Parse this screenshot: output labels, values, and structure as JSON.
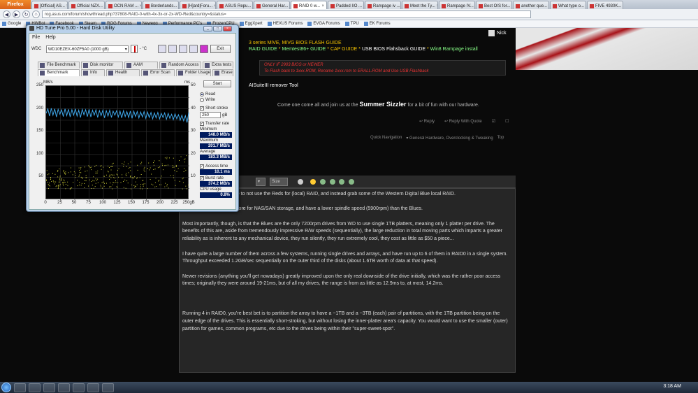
{
  "browser": {
    "app_button": "Firefox",
    "tabs": [
      {
        "label": "[Official] AS...",
        "active": false
      },
      {
        "label": "Official NZX...",
        "active": false
      },
      {
        "label": "OCN RAM ...",
        "active": false
      },
      {
        "label": "Borderlands...",
        "active": false
      },
      {
        "label": "[H]ard|Foru...",
        "active": false
      },
      {
        "label": "ASUS Repu...",
        "active": false
      },
      {
        "label": "General Har...",
        "active": false
      },
      {
        "label": "RAID 0 w...",
        "active": true
      },
      {
        "label": "Padded I/O ...",
        "active": false
      },
      {
        "label": "Rampage iv ...",
        "active": false
      },
      {
        "label": "Meet the Ty...",
        "active": false
      },
      {
        "label": "Rampage IV...",
        "active": false
      },
      {
        "label": "Best O/S for...",
        "active": false
      },
      {
        "label": "another que...",
        "active": false
      },
      {
        "label": "What type o...",
        "active": false
      },
      {
        "label": "FIVE 4930K...",
        "active": false
      }
    ],
    "url": "rog.asus.com/forum/showthread.php?37808-RAID-0-with-4x-3x-or-2x-WD-Red&country=&status=",
    "bookmarks": [
      "Google",
      "HWBot",
      "Facebook",
      "Steam",
      "ROG Forums",
      "Newegg",
      "Performance PC's",
      "FrozenCPU",
      "EggXpert",
      "HEXUS Forums",
      "EVGA Forums",
      "TPU",
      "EK Forums"
    ]
  },
  "forum": {
    "user": "Nick",
    "sig_line1": "3 series MIVE, MIVG BIOS FLASH GUIDE",
    "sig_line2_a": "RAID GUIDE",
    "sig_line2_b": "Memtest86+ GUIDE",
    "sig_line2_c": "CAP GUIDE",
    "sig_line2_d": "USB BIOS Flahsback GUIDE",
    "sig_line2_e": "Win8 Rampage install",
    "red_line1": "ONLY IF 2903 BIOS or NEWER",
    "red_line2": "To Flash back to 1xxx.ROM, Rename 1xxx.rom to ERALL.ROM and Use USB Flashback",
    "aisuite": "AISuiteIII remover Tool",
    "sizzle_pre": "Come one come all and join us at the",
    "sizzle_bold": "Summer Sizzler",
    "sizzle_post": "for a bit of fun with our hardware.",
    "actions": [
      "Reply",
      "Reply With Quote"
    ],
    "quicknav": [
      "Quick Navigation",
      "General Hardware, Overclocking & Tweaking",
      "Top"
    ],
    "editor": {
      "size_label": "Size",
      "paragraphs": [
        "gestion, and that would be to not use the Reds for (local) RAID, and instead grab some of the Western Digital Blue local RAID.",
        "The Reds are designed more for NAS/SAN storage, and have a lower spindle speed (5900rpm) than the Blues.",
        "Most importantly, though, is that the Blues are the only 7200rpm drives from WD to use single 1TB platters, meaning only 1 platter per drive. The benefits of this are, aside from tremendously impressive R/W speeds (sequentially), the large reduction in total moving parts which imparts a greater reliability as is inherent to any mechanical device, they run silently, they run extremely cool, they cost as little as $50 a piece...",
        "I have quite a large number of them across a few systems, running single drives and arrays, and have run up to 6 of them in RAID0 in a single system.  Throughput exceeded 1.2GB/sec sequentially on the outer third of the disks (about 1.6TB worth of data at that speed).",
        "Newer revisions (anything you'll get nowadays) greatly improved upon the only real downside of the drive initially, which was the rather poor access times; originally they were around 19-21ms, but of all my drives, the range is from as little as 12.9ms to, at most, 14.2ms.",
        "",
        "Running 4 in RAID0, you're best bet is to partition the array to have a ~1TB and a ~3TB (each) pair of partitions, with the 1TB partition being on the outer edge of the drives. This is essentially short-stroking, but without losing the inner-platter area's capacity.  You would want to use the smaller (outer) partition for games, common programs, etc due to the drives being within their \"super-sweet-spot\"."
      ]
    }
  },
  "hdtune": {
    "title": "HD Tune Pro 5.00 - Hard Disk Utility",
    "menu": [
      "File",
      "Help"
    ],
    "drive_label": "WDC",
    "drive": "WD10EZEX-60ZF5A0 (1000 gB)",
    "temp": "- °C",
    "exit": "Exit",
    "tabs_row1": [
      "File Benchmark",
      "Disk monitor",
      "AAM",
      "Random Access",
      "Extra tests"
    ],
    "tabs_row2": [
      "Benchmark",
      "Info",
      "Health",
      "Error Scan",
      "Folder Usage",
      "Erase"
    ],
    "start": "Start",
    "read": "Read",
    "write": "Write",
    "short_stroke": "Short stroke",
    "short_stroke_value": "250",
    "short_stroke_unit": "gB",
    "transfer_rate": "Transfer rate",
    "minimum_label": "Minimum",
    "minimum": "148.0 MB/s",
    "maximum_label": "Maximum",
    "maximum": "201.7 MB/s",
    "average_label": "Average",
    "average": "183.3 MB/s",
    "access_time": "Access time",
    "access_value": "10.1 ms",
    "burst_rate": "Burst rate",
    "burst_value": "374.2 MB/s",
    "cpu_label": "CPU usage",
    "cpu_value": "0.8%"
  },
  "chart_data": {
    "type": "line",
    "ylabel": "MB/s",
    "ylabel_right": "ms",
    "ylim": [
      0,
      250
    ],
    "ylim_right": [
      0,
      50
    ],
    "xlim": [
      0,
      250
    ],
    "x_ticks": [
      "0",
      "25",
      "50",
      "75",
      "100",
      "125",
      "150",
      "175",
      "200",
      "225",
      "250gB"
    ],
    "y_ticks": [
      "250",
      "200",
      "150",
      "100",
      "50"
    ],
    "y_ticks_right": [
      "50",
      "40",
      "30",
      "20",
      "10"
    ],
    "transfer_rate_series": {
      "x": [
        0,
        3,
        6,
        9,
        12,
        15,
        18,
        21,
        24,
        27,
        30,
        33,
        36,
        39,
        42,
        45,
        48,
        51,
        54,
        57,
        60,
        63,
        66,
        69,
        72,
        75,
        78,
        81,
        84,
        87,
        90,
        93,
        96,
        99,
        102,
        105,
        108,
        111,
        114,
        117,
        120,
        123,
        126,
        129,
        132,
        135,
        138,
        141,
        144,
        147,
        150,
        153,
        156,
        159,
        162,
        165,
        168,
        171,
        174,
        177,
        180,
        183,
        186,
        189,
        192,
        195,
        198,
        201,
        204,
        207,
        210,
        213,
        216,
        219,
        222,
        225,
        228,
        231,
        234,
        237,
        240,
        243,
        246,
        249
      ],
      "y": [
        190,
        200,
        184,
        201,
        186,
        200,
        182,
        199,
        188,
        198,
        183,
        200,
        185,
        199,
        182,
        198,
        186,
        200,
        184,
        197,
        181,
        199,
        187,
        198,
        183,
        199,
        182,
        197,
        186,
        198,
        181,
        196,
        185,
        197,
        180,
        196,
        184,
        197,
        181,
        195,
        186,
        196,
        182,
        195,
        180,
        196,
        183,
        194,
        181,
        195,
        179,
        195,
        183,
        194,
        180,
        193,
        182,
        194,
        179,
        193,
        181,
        192,
        178,
        191,
        180,
        192,
        178,
        190,
        181,
        191,
        177,
        190,
        179,
        188,
        176,
        189,
        178,
        187,
        175,
        186,
        174,
        185,
        170,
        192
      ]
    },
    "access_time_range_ms": [
      5,
      20
    ]
  },
  "taskbar": {
    "clock": "3:18 AM"
  }
}
